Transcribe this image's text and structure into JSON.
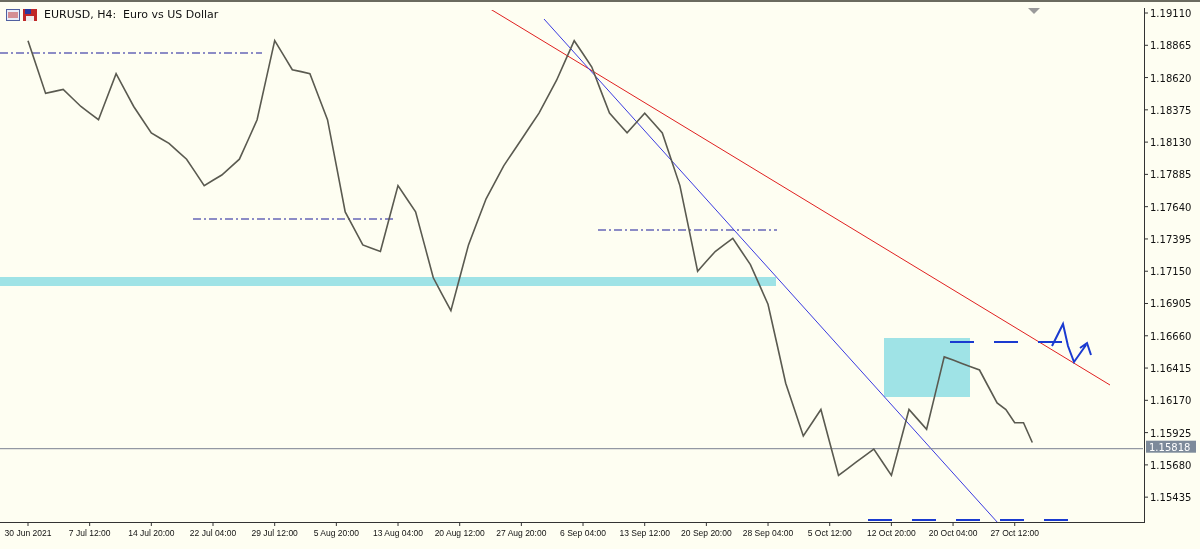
{
  "chart_window": {
    "title": "EURUSD, H4:  Euro vs US Dollar",
    "chart_data": {
      "type": "line",
      "ylim": [
        1.15254,
        1.19148
      ],
      "categories": [
        "30 Jun 2021",
        null,
        null,
        null,
        null,
        null,
        null,
        "7 Jul 12:00",
        null,
        null,
        null,
        null,
        null,
        null,
        "14 Jul 20:00",
        null,
        null,
        null,
        null,
        null,
        null,
        "22 Jul 04:00",
        null,
        null,
        null,
        null,
        null,
        null,
        "29 Jul 12:00",
        null,
        null,
        null,
        null,
        null,
        null,
        "5 Aug 20:00",
        null,
        null,
        null,
        null,
        null,
        null,
        "13 Aug 04:00",
        null,
        null,
        null,
        null,
        null,
        null,
        "20 Aug 12:00",
        null,
        null,
        null,
        null,
        null,
        null,
        "27 Aug 20:00",
        null,
        null,
        null,
        null,
        null,
        null,
        "6 Sep 04:00",
        null,
        null,
        null,
        null,
        null,
        null,
        "13 Sep 12:00",
        null,
        null,
        null,
        null,
        null,
        null,
        "20 Sep 20:00",
        null,
        null,
        null,
        null,
        null,
        null,
        "28 Sep 04:00",
        null,
        null,
        null,
        null,
        null,
        null,
        "5 Oct 12:00",
        null,
        null,
        null,
        null,
        null,
        null,
        "12 Oct 20:00",
        null,
        null,
        null,
        null,
        null,
        null,
        "20 Oct 04:00",
        null,
        null,
        null,
        null,
        null,
        null,
        "27 Oct 12:00",
        null,
        null
      ],
      "series": [
        {
          "color": "#5a5a50",
          "values": [
            1.189,
            1.187,
            1.185,
            1.18515,
            1.1853,
            1.18465,
            1.184,
            1.1835,
            1.183,
            1.18475,
            1.1865,
            1.18525,
            1.184,
            1.183,
            1.182,
            1.1816,
            1.1812,
            1.1806,
            1.18,
            1.179,
            1.178,
            1.1784,
            1.1788,
            1.1794,
            1.18,
            1.1815,
            1.183,
            1.186,
            1.189,
            1.1879,
            1.1868,
            1.18665,
            1.1865,
            1.18475,
            1.183,
            1.1795,
            1.176,
            1.17475,
            1.1735,
            1.17325,
            1.173,
            1.1755,
            1.178,
            1.177,
            1.176,
            1.1735,
            1.171,
            1.16975,
            1.1685,
            1.171,
            1.1735,
            1.17525,
            1.177,
            1.17825,
            1.1795,
            1.1805,
            1.1815,
            1.1825,
            1.1835,
            1.18475,
            1.186,
            1.1875,
            1.189,
            1.188,
            1.187,
            1.18525,
            1.1835,
            1.18275,
            1.182,
            1.18275,
            1.1835,
            1.18275,
            1.182,
            1.18,
            1.178,
            1.17475,
            1.1715,
            1.17225,
            1.173,
            1.1735,
            1.174,
            1.173,
            1.172,
            1.1705,
            1.169,
            1.166,
            1.163,
            1.161,
            1.159,
            1.16,
            1.161,
            1.1585,
            1.156,
            1.1565,
            1.157,
            1.1575,
            1.158,
            1.157,
            1.156,
            1.1585,
            1.161,
            1.16025,
            1.1595,
            1.16225,
            1.165,
            1.16475,
            1.1645,
            1.16425,
            1.164,
            1.16275,
            1.1615,
            1.161,
            1.16,
            1.16,
            1.1585
          ]
        }
      ],
      "yticks": [
        {
          "value": 1.1911,
          "label": "1.19110"
        },
        {
          "value": 1.18865,
          "label": "1.18865"
        },
        {
          "value": 1.1862,
          "label": "1.18620"
        },
        {
          "value": 1.18375,
          "label": "1.18375"
        },
        {
          "value": 1.1813,
          "label": "1.18130"
        },
        {
          "value": 1.17885,
          "label": "1.17885"
        },
        {
          "value": 1.1764,
          "label": "1.17640"
        },
        {
          "value": 1.17395,
          "label": "1.17395"
        },
        {
          "value": 1.1715,
          "label": "1.17150"
        },
        {
          "value": 1.16905,
          "label": "1.16905"
        },
        {
          "value": 1.1666,
          "label": "1.16660"
        },
        {
          "value": 1.16415,
          "label": "1.16415"
        },
        {
          "value": 1.1617,
          "label": "1.16170"
        },
        {
          "value": 1.15925,
          "label": "1.15925"
        },
        {
          "value": 1.1568,
          "label": "1.15680"
        },
        {
          "value": 1.15435,
          "label": "1.15435"
        }
      ]
    },
    "current_price": "1.15818"
  }
}
